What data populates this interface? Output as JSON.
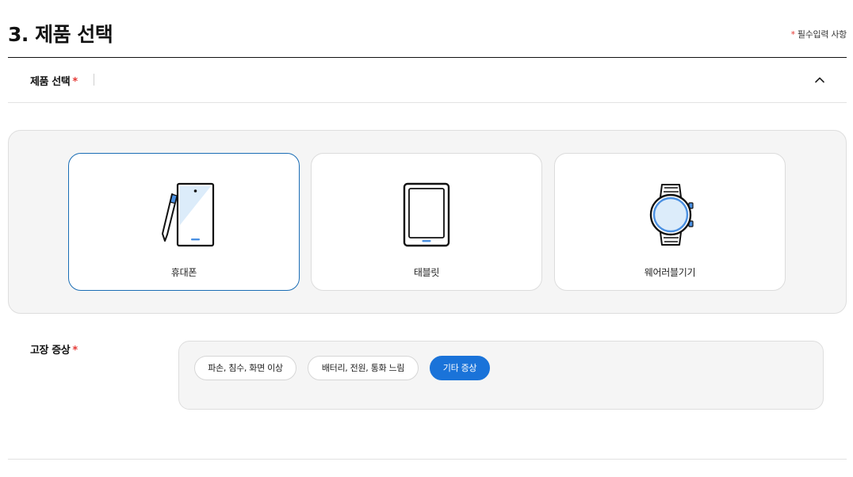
{
  "header": {
    "title": "3. 제품 선택",
    "required_star": "*",
    "required_note": "필수입력 사항"
  },
  "product_section": {
    "label": "제품 선택",
    "star": "*",
    "chevron_icon": "chevron-up-icon",
    "cards": [
      {
        "label": "휴대폰",
        "icon": "phone-with-pen-icon",
        "selected": true
      },
      {
        "label": "태블릿",
        "icon": "tablet-icon",
        "selected": false
      },
      {
        "label": "웨어러블기기",
        "icon": "smartwatch-icon",
        "selected": false
      }
    ]
  },
  "symptom_section": {
    "label": "고장 증상",
    "star": "*",
    "chips": [
      {
        "label": "파손, 침수, 화면 이상",
        "active": false
      },
      {
        "label": "배터리, 전원, 통화 느림",
        "active": false
      },
      {
        "label": "기타 증상",
        "active": true
      }
    ]
  },
  "colors": {
    "accent": "#1a73d9",
    "selected_border": "#1a6db5",
    "required_star": "#e53935",
    "icon_highlight": "#4a90e2"
  }
}
